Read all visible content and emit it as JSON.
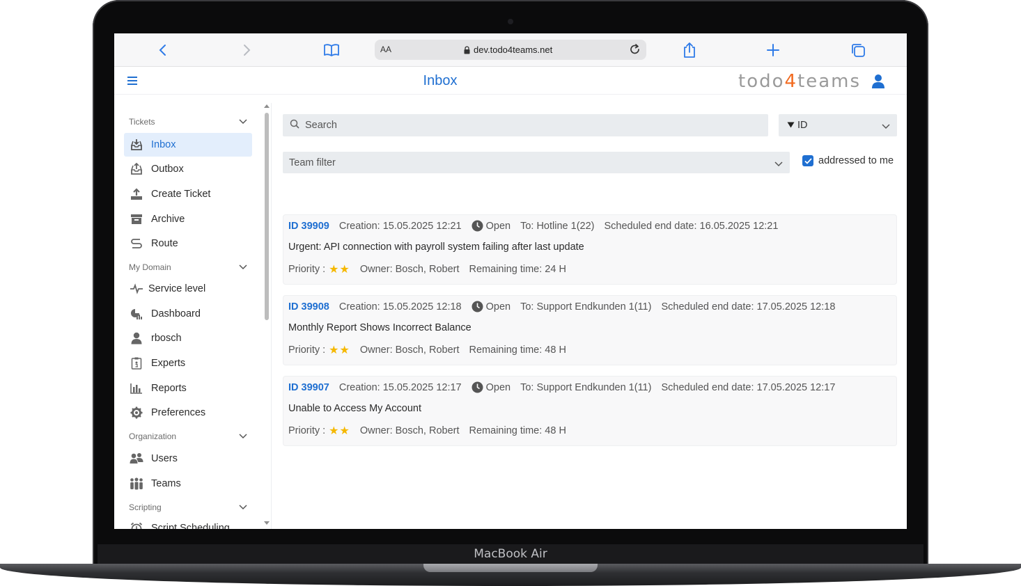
{
  "device": {
    "label": "MacBook Air"
  },
  "browser": {
    "text_size_label": "AA",
    "url": "dev.todo4teams.net"
  },
  "app": {
    "title": "Inbox",
    "logo_prefix": "todo",
    "logo_number": "4",
    "logo_suffix": "teams",
    "accent_color": "#1f6fd1",
    "logo_accent_color": "#f26b21"
  },
  "sidebar": {
    "sections": [
      {
        "label": "Tickets"
      },
      {
        "label": "My Domain"
      },
      {
        "label": "Organization"
      },
      {
        "label": "Scripting"
      }
    ],
    "items": [
      {
        "label": "Inbox",
        "icon": "inbox-download-icon",
        "active": true
      },
      {
        "label": "Outbox",
        "icon": "outbox-upload-icon"
      },
      {
        "label": "Create Ticket",
        "icon": "upload-tray-icon"
      },
      {
        "label": "Archive",
        "icon": "archive-box-icon"
      },
      {
        "label": "Route",
        "icon": "route-icon"
      },
      {
        "label": "Service level",
        "icon": "pulse-icon"
      },
      {
        "label": "Dashboard",
        "icon": "dashboard-chart-icon"
      },
      {
        "label": "rbosch",
        "icon": "user-icon"
      },
      {
        "label": "Experts",
        "icon": "id-badge-icon"
      },
      {
        "label": "Reports",
        "icon": "bar-chart-icon"
      },
      {
        "label": "Preferences",
        "icon": "gear-icon"
      },
      {
        "label": "Users",
        "icon": "users-icon"
      },
      {
        "label": "Teams",
        "icon": "teams-icon"
      },
      {
        "label": "Script Scheduling",
        "icon": "alarm-clock-icon"
      }
    ]
  },
  "filters": {
    "search_placeholder": "Search",
    "sort_label": "ID",
    "team_filter_label": "Team filter",
    "addressed_to_me_label": "addressed to me",
    "addressed_to_me_checked": true
  },
  "tickets": [
    {
      "id": "ID 39909",
      "creation": "Creation: 15.05.2025 12:21",
      "status": "Open",
      "to": "To: Hotline 1(22)",
      "scheduled_end": "Scheduled end date: 16.05.2025 12:21",
      "subject": "Urgent: API connection with payroll system failing after last update",
      "priority_label": "Priority :",
      "priority_stars": 2,
      "owner": "Owner: Bosch, Robert",
      "remaining": "Remaining time: 24 H"
    },
    {
      "id": "ID 39908",
      "creation": "Creation: 15.05.2025 12:18",
      "status": "Open",
      "to": "To: Support Endkunden 1(11)",
      "scheduled_end": "Scheduled end date: 17.05.2025 12:18",
      "subject": "Monthly Report Shows Incorrect Balance",
      "priority_label": "Priority :",
      "priority_stars": 2,
      "owner": "Owner: Bosch, Robert",
      "remaining": "Remaining time: 48 H"
    },
    {
      "id": "ID 39907",
      "creation": "Creation: 15.05.2025 12:17",
      "status": "Open",
      "to": "To: Support Endkunden 1(11)",
      "scheduled_end": "Scheduled end date: 17.05.2025 12:17",
      "subject": "Unable to Access My Account",
      "priority_label": "Priority :",
      "priority_stars": 2,
      "owner": "Owner: Bosch, Robert",
      "remaining": "Remaining time: 48 H"
    }
  ]
}
